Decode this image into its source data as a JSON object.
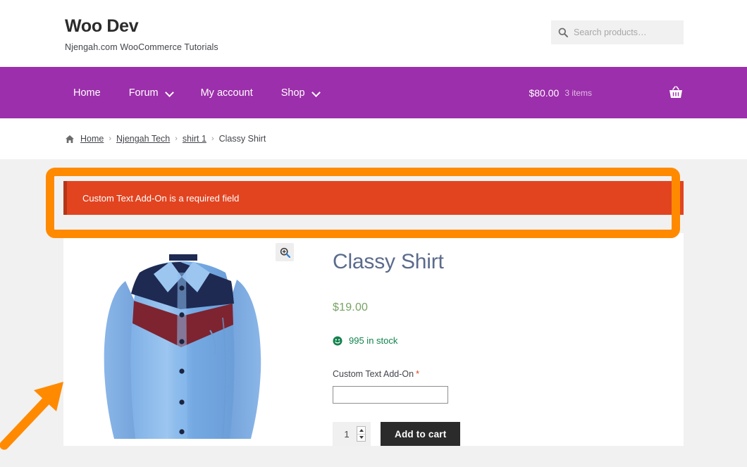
{
  "header": {
    "site_title": "Woo Dev",
    "tagline": "Njengah.com WooCommerce Tutorials",
    "search": {
      "placeholder": "Search products…",
      "value": "",
      "icon": "search-icon"
    }
  },
  "nav": {
    "items": [
      {
        "label": "Home",
        "has_dropdown": false
      },
      {
        "label": "Forum",
        "has_dropdown": true
      },
      {
        "label": "My account",
        "has_dropdown": false
      },
      {
        "label": "Shop",
        "has_dropdown": true
      }
    ],
    "cart": {
      "amount": "$80.00",
      "count": "3 items",
      "icon": "shopping-basket-icon"
    },
    "background_color": "#9c2fab"
  },
  "breadcrumb": {
    "home_icon": "home-icon",
    "items": [
      {
        "label": "Home",
        "is_link": true
      },
      {
        "label": "Njengah Tech",
        "is_link": true
      },
      {
        "label": "shirt 1",
        "is_link": true
      },
      {
        "label": "Classy Shirt",
        "is_link": false
      }
    ],
    "separator": "›"
  },
  "notice": {
    "message": "Custom Text Add-On is a required field",
    "background_color": "#e24420",
    "border_color": "#b5351a"
  },
  "annotation": {
    "highlight_color": "#ff8a00",
    "shape": "rounded-rectangle-outline",
    "arrow": "arrow-pointing-up-right"
  },
  "product": {
    "title": "Classy Shirt",
    "price": "$19.00",
    "stock_status": "995 in stock",
    "stock_icon": "green-smiley-icon",
    "zoom_icon": "magnifier-plus-icon",
    "image_alt": "Classy Shirt",
    "addon": {
      "label": "Custom Text Add-On",
      "required_marker": "*",
      "value": "",
      "placeholder": ""
    },
    "quantity": {
      "value": "1",
      "increment_icon": "chevron-up-icon",
      "decrement_icon": "chevron-down-icon"
    },
    "add_to_cart_label": "Add to cart"
  },
  "colors": {
    "page_background": "#f1f1f1",
    "card_background": "#ffffff",
    "brand_purple": "#9c2fab",
    "price_green": "#77a464",
    "stock_green": "#0f834d",
    "title_blue_gray": "#5b6b8c",
    "button_dark": "#2b2b2b"
  }
}
